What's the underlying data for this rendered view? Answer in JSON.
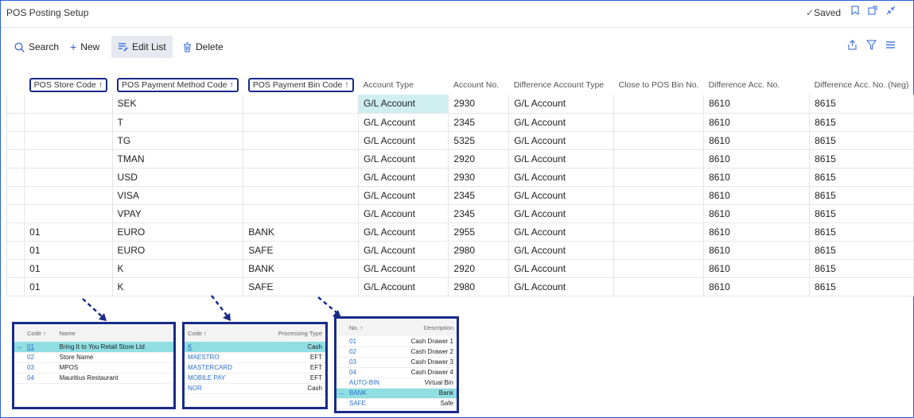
{
  "window": {
    "title": "POS Posting Setup",
    "saved": "Saved"
  },
  "actions": {
    "search": "Search",
    "new": "New",
    "edit_list": "Edit List",
    "delete": "Delete"
  },
  "columns": [
    "POS Store Code ↑",
    "POS Payment Method Code ↑",
    "POS Payment Bin Code ↑",
    "Account Type",
    "Account No.",
    "Difference Account Type",
    "Close to POS Bin No.",
    "Difference Acc. No.",
    "Difference Acc. No. (Neg)"
  ],
  "rows": [
    [
      "",
      "SEK",
      "",
      "G/L Account",
      "2930",
      "G/L Account",
      "",
      "8610",
      "8615"
    ],
    [
      "",
      "T",
      "",
      "G/L Account",
      "2345",
      "G/L Account",
      "",
      "8610",
      "8615"
    ],
    [
      "",
      "TG",
      "",
      "G/L Account",
      "5325",
      "G/L Account",
      "",
      "8610",
      "8615"
    ],
    [
      "",
      "TMAN",
      "",
      "G/L Account",
      "2920",
      "G/L Account",
      "",
      "8610",
      "8615"
    ],
    [
      "",
      "USD",
      "",
      "G/L Account",
      "2930",
      "G/L Account",
      "",
      "8610",
      "8615"
    ],
    [
      "",
      "VISA",
      "",
      "G/L Account",
      "2345",
      "G/L Account",
      "",
      "8610",
      "8615"
    ],
    [
      "",
      "VPAY",
      "",
      "G/L Account",
      "2345",
      "G/L Account",
      "",
      "8610",
      "8615"
    ],
    [
      "01",
      "EURO",
      "BANK",
      "G/L Account",
      "2955",
      "G/L Account",
      "",
      "8610",
      "8615"
    ],
    [
      "01",
      "EURO",
      "SAFE",
      "G/L Account",
      "2980",
      "G/L Account",
      "",
      "8610",
      "8615"
    ],
    [
      "01",
      "K",
      "BANK",
      "G/L Account",
      "2920",
      "G/L Account",
      "",
      "8610",
      "8615"
    ],
    [
      "01",
      "K",
      "SAFE",
      "G/L Account",
      "2980",
      "G/L Account",
      "",
      "8610",
      "8615"
    ]
  ],
  "popups": {
    "store": {
      "headers": [
        "Code ↑",
        "Name"
      ],
      "rows": [
        [
          "01",
          "Bring It to You Retail Store Ltd"
        ],
        [
          "02",
          "Store Name"
        ],
        [
          "03",
          "MPOS"
        ],
        [
          "04",
          "Mauritius Restaurant"
        ]
      ],
      "selected": 0
    },
    "method": {
      "headers": [
        "Code ↑",
        "Processing Type"
      ],
      "rows": [
        [
          "K",
          "Cash"
        ],
        [
          "MAESTRO",
          "EFT"
        ],
        [
          "MASTERCARD",
          "EFT"
        ],
        [
          "MOBILE PAY",
          "EFT"
        ],
        [
          "NOR",
          "Cash"
        ]
      ],
      "selected": 0
    },
    "bin": {
      "headers": [
        "No. ↑",
        "Description"
      ],
      "rows": [
        [
          "01",
          "Cash Drawer 1"
        ],
        [
          "02",
          "Cash Drawer 2"
        ],
        [
          "03",
          "Cash Drawer 3"
        ],
        [
          "04",
          "Cash Drawer 4"
        ],
        [
          "AUTO-BIN",
          "Virtual Bin"
        ],
        [
          "BANK",
          "Bank"
        ],
        [
          "SAFE",
          "Safe"
        ]
      ],
      "selected": 5
    }
  },
  "colors": {
    "accent": "#2b5fd9",
    "highlight_box": "#1a2a8a",
    "selected_cell": "#cfeef0"
  }
}
